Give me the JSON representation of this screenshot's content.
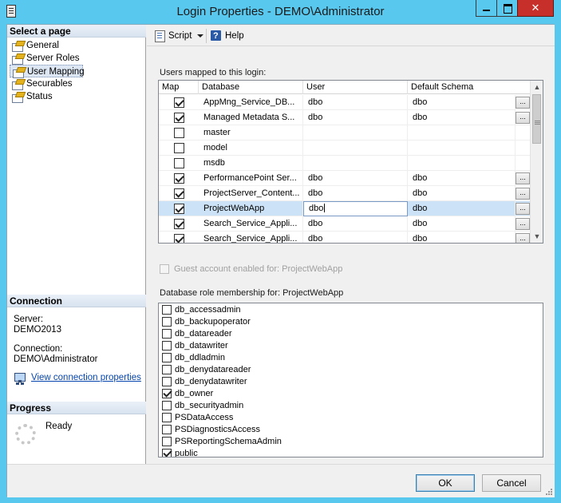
{
  "window": {
    "title": "Login Properties - DEMO\\Administrator"
  },
  "left": {
    "select_page_header": "Select a page",
    "pages": [
      {
        "label": "General",
        "selected": false
      },
      {
        "label": "Server Roles",
        "selected": false
      },
      {
        "label": "User Mapping",
        "selected": true
      },
      {
        "label": "Securables",
        "selected": false
      },
      {
        "label": "Status",
        "selected": false
      }
    ],
    "connection_header": "Connection",
    "server_label": "Server:",
    "server_value": "DEMO2013",
    "connection_label": "Connection:",
    "connection_value": "DEMO\\Administrator",
    "view_connection_link": "View connection properties",
    "progress_header": "Progress",
    "progress_status": "Ready"
  },
  "toolbar": {
    "script_label": "Script",
    "help_label": "Help"
  },
  "users": {
    "section_label": "Users mapped to this login:",
    "columns": [
      "Map",
      "Database",
      "User",
      "Default Schema"
    ],
    "rows": [
      {
        "map": true,
        "database": "AppMng_Service_DB...",
        "user": "dbo",
        "schema": "dbo",
        "dots": true,
        "selected": false
      },
      {
        "map": true,
        "database": "Managed Metadata S...",
        "user": "dbo",
        "schema": "dbo",
        "dots": true,
        "selected": false
      },
      {
        "map": false,
        "database": "master",
        "user": "",
        "schema": "",
        "dots": false,
        "selected": false
      },
      {
        "map": false,
        "database": "model",
        "user": "",
        "schema": "",
        "dots": false,
        "selected": false
      },
      {
        "map": false,
        "database": "msdb",
        "user": "",
        "schema": "",
        "dots": false,
        "selected": false
      },
      {
        "map": true,
        "database": "PerformancePoint Ser...",
        "user": "dbo",
        "schema": "dbo",
        "dots": true,
        "selected": false
      },
      {
        "map": true,
        "database": "ProjectServer_Content...",
        "user": "dbo",
        "schema": "dbo",
        "dots": true,
        "selected": false
      },
      {
        "map": true,
        "database": "ProjectWebApp",
        "user": "dbo",
        "schema": "dbo",
        "dots": true,
        "selected": true
      },
      {
        "map": true,
        "database": "Search_Service_Appli...",
        "user": "dbo",
        "schema": "dbo",
        "dots": true,
        "selected": false
      },
      {
        "map": true,
        "database": "Search_Service_Appli...",
        "user": "dbo",
        "schema": "dbo",
        "dots": true,
        "selected": false
      }
    ],
    "dots_label": "..."
  },
  "guest": {
    "label": "Guest account enabled for: ProjectWebApp",
    "checked": false
  },
  "roles": {
    "section_label": "Database role membership for: ProjectWebApp",
    "items": [
      {
        "label": "db_accessadmin",
        "checked": false
      },
      {
        "label": "db_backupoperator",
        "checked": false
      },
      {
        "label": "db_datareader",
        "checked": false
      },
      {
        "label": "db_datawriter",
        "checked": false
      },
      {
        "label": "db_ddladmin",
        "checked": false
      },
      {
        "label": "db_denydatareader",
        "checked": false
      },
      {
        "label": "db_denydatawriter",
        "checked": false
      },
      {
        "label": "db_owner",
        "checked": true
      },
      {
        "label": "db_securityadmin",
        "checked": false
      },
      {
        "label": "PSDataAccess",
        "checked": false
      },
      {
        "label": "PSDiagnosticsAccess",
        "checked": false
      },
      {
        "label": "PSReportingSchemaAdmin",
        "checked": false
      },
      {
        "label": "public",
        "checked": true
      }
    ]
  },
  "footer": {
    "ok_label": "OK",
    "cancel_label": "Cancel"
  }
}
